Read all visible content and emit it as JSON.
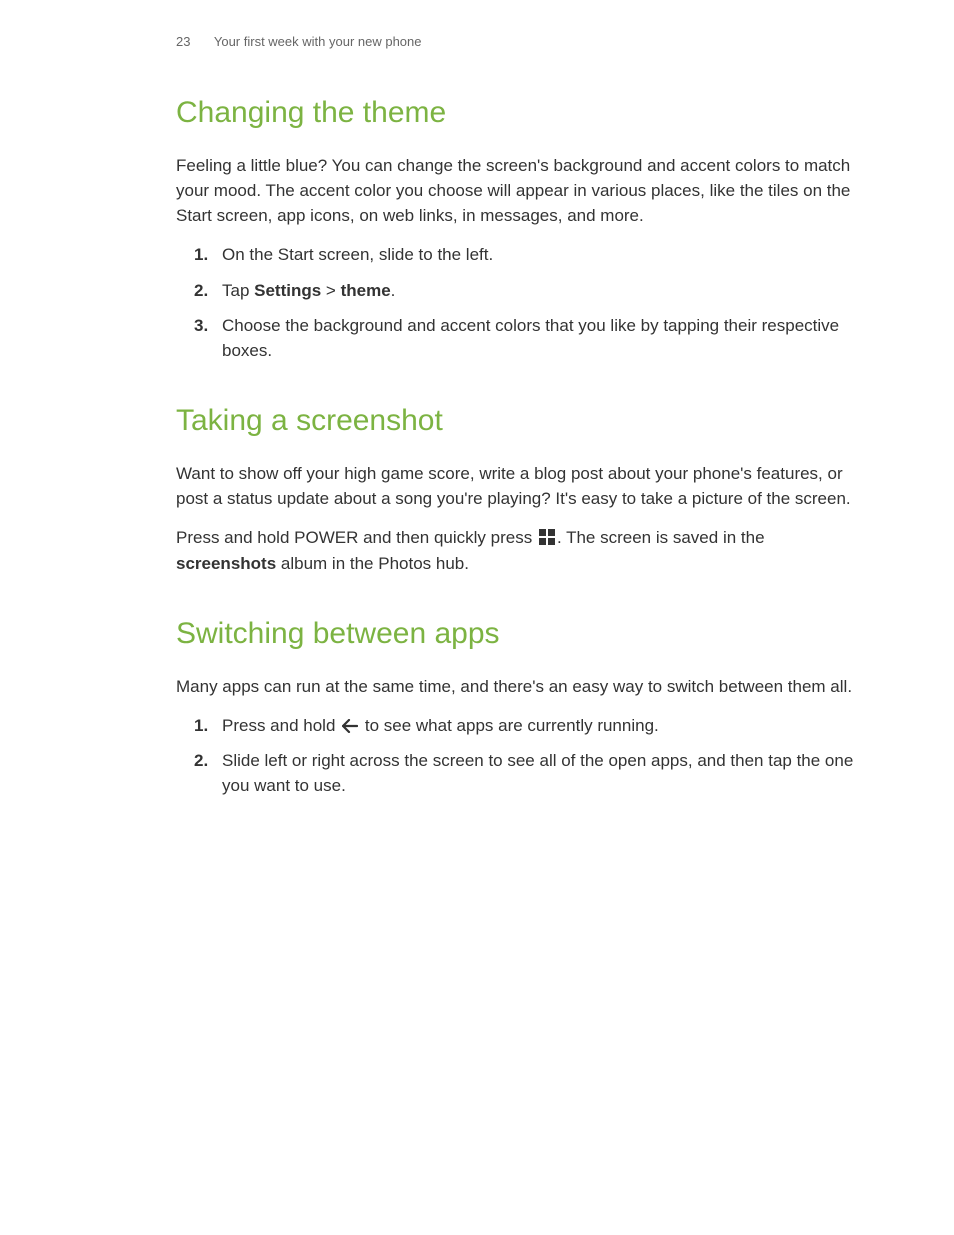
{
  "header": {
    "pageNumber": "23",
    "chapter": "Your first week with your new phone"
  },
  "sections": [
    {
      "title": "Changing the theme",
      "intro": "Feeling a little blue? You can change the screen's background and accent colors to match your mood. The accent color you choose will appear in various places, like the tiles on the Start screen, app icons, on web links, in messages, and more.",
      "steps": [
        {
          "text": "On the Start screen, slide to the left."
        },
        {
          "pre": "Tap ",
          "b1": "Settings",
          "mid": " > ",
          "b2": "theme",
          "post": "."
        },
        {
          "text": "Choose the background and accent colors that you like by tapping their respective boxes."
        }
      ]
    },
    {
      "title": "Taking a screenshot",
      "intro": "Want to show off your high game score, write a blog post about your phone's features, or post a status update about a song you're playing? It's easy to take a picture of the screen.",
      "body": {
        "pre": "Press and hold POWER and then quickly press ",
        "post1": ". The screen is saved in the ",
        "bold": "screenshots",
        "post2": " album in the Photos hub."
      }
    },
    {
      "title": "Switching between apps",
      "intro": "Many apps can run at the same time, and there's an easy way to switch between them all.",
      "steps": [
        {
          "pre": "Press and hold ",
          "post": " to see what apps are currently running."
        },
        {
          "text": "Slide left or right across the screen to see all of the open apps, and then tap the one you want to use."
        }
      ]
    }
  ]
}
